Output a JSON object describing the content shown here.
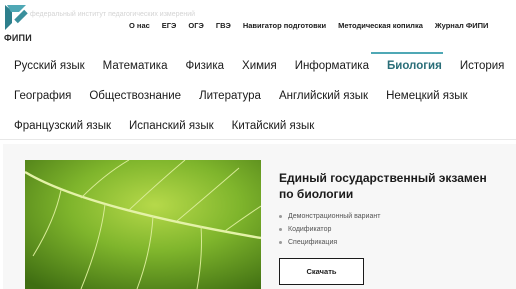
{
  "header": {
    "logo_text": "ФИПИ",
    "tagline": "федеральный институт педагогических измерений",
    "brand_color": "#4fa8b5",
    "nav": [
      "О нас",
      "ЕГЭ",
      "ОГЭ",
      "ГВЭ",
      "Навигатор подготовки",
      "Методическая копилка",
      "Журнал ФИПИ"
    ]
  },
  "subjects": {
    "row1": [
      "Русский язык",
      "Математика",
      "Физика",
      "Химия",
      "Информатика",
      "Биология",
      "История"
    ],
    "row2": [
      "География",
      "Обществознание",
      "Литература",
      "Английский язык",
      "Немецкий язык"
    ],
    "row3": [
      "Французский язык",
      "Испанский язык",
      "Китайский язык"
    ],
    "active": "Биология"
  },
  "exam": {
    "title": "Единый государственный экзамен по биологии",
    "links": [
      "Демонстрационный вариант",
      "Кодификатор",
      "Спецификация"
    ],
    "download_label": "Скачать",
    "image_icon": "green-leaf-image"
  }
}
